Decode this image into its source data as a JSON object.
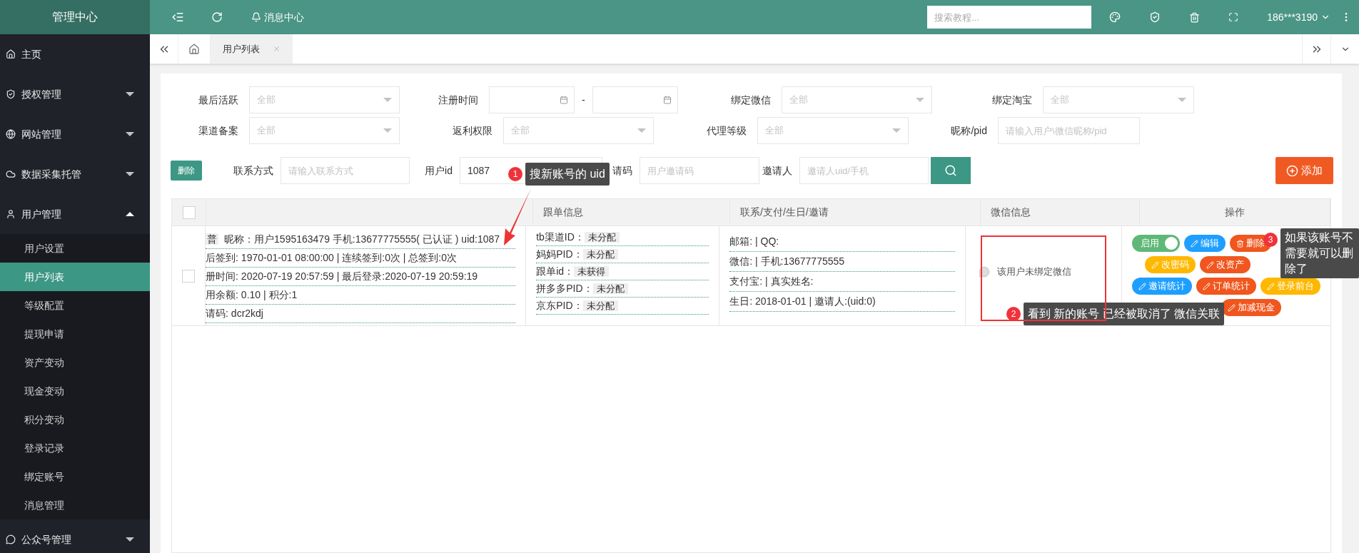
{
  "sidebar": {
    "title": "管理中心",
    "items": [
      {
        "label": "主页"
      },
      {
        "label": "授权管理",
        "expanded": false
      },
      {
        "label": "网站管理",
        "expanded": false
      },
      {
        "label": "数据采集托管",
        "expanded": false
      },
      {
        "label": "用户管理",
        "expanded": true,
        "children": [
          {
            "label": "用户设置",
            "selected": false
          },
          {
            "label": "用户列表",
            "selected": true
          },
          {
            "label": "等级配置",
            "selected": false
          },
          {
            "label": "提现申请",
            "selected": false
          },
          {
            "label": "资产变动",
            "selected": false
          },
          {
            "label": "现金变动",
            "selected": false
          },
          {
            "label": "积分变动",
            "selected": false
          },
          {
            "label": "登录记录",
            "selected": false
          },
          {
            "label": "绑定账号",
            "selected": false
          },
          {
            "label": "消息管理",
            "selected": false
          }
        ]
      },
      {
        "label": "公众号管理",
        "expanded": false
      }
    ]
  },
  "topbar": {
    "notice": "消息中心",
    "search_placeholder": "搜索教程...",
    "user": "186***3190"
  },
  "tabs": [
    {
      "label": "用户列表",
      "selected": true
    }
  ],
  "filter_rows": [
    [
      {
        "label": "最后活跃",
        "kind": "select",
        "placeholder": "全部"
      },
      {
        "label": "注册时间",
        "kind": "date_range",
        "separator": "-"
      },
      {
        "label": "绑定微信",
        "kind": "select",
        "placeholder": "全部"
      },
      {
        "label": "绑定淘宝",
        "kind": "select",
        "placeholder": "全部"
      }
    ],
    [
      {
        "label": "渠道备案",
        "kind": "select",
        "placeholder": "全部"
      },
      {
        "label": "返利权限",
        "kind": "select",
        "placeholder": "全部"
      },
      {
        "label": "代理等级",
        "kind": "select",
        "placeholder": "全部"
      },
      {
        "label": "昵称/pid",
        "kind": "text",
        "placeholder": "请输入用户\\微信昵称/pid"
      }
    ]
  ],
  "action_row": {
    "delete": "删除",
    "fields": [
      {
        "label": "联系方式",
        "placeholder": "请输入联系方式"
      },
      {
        "label": "用户id",
        "value": "1087"
      },
      {
        "label": "请码",
        "placeholder": "用户邀请码"
      },
      {
        "label": "邀请人",
        "placeholder": "邀请人uid/手机"
      }
    ],
    "add": "添加"
  },
  "table": {
    "header_checked": false,
    "columns": [
      "跟单信息",
      "联系/支付/生日/邀请",
      "微信信息",
      "操作"
    ],
    "rows": [
      {
        "checked": false,
        "user": {
          "tag": "普",
          "lines": [
            "昵称：用户1595163479  手机:13677775555( 已认证 )   uid:1087",
            "后签到: 1970-01-01 08:00:00  |  连续签到:0次  |  总签到:0次",
            "册时间: 2020-07-19 20:57:59  |  最后登录:2020-07-19 20:59:19",
            "用余额: 0.10  |  积分:1",
            "请码: dcr2kdj"
          ]
        },
        "tracking": [
          {
            "label": "tb渠道ID：",
            "value": "未分配"
          },
          {
            "label": "妈妈PID：",
            "value": "未分配"
          },
          {
            "label": "跟单id：",
            "value": "未获得"
          },
          {
            "label": "拼多多PID：",
            "value": "未分配"
          },
          {
            "label": "京东PID：",
            "value": "未分配"
          }
        ],
        "contact": [
          "邮箱:  |  QQ:",
          "微信:  |  手机:13677775555",
          "支付宝:  |  真实姓名:",
          "生日: 2018-01-01  |  邀请人:(uid:0)"
        ],
        "wechat": "该用户未绑定微信",
        "actions": [
          [
            {
              "kind": "toggle",
              "label": "启用",
              "on": true
            },
            {
              "kind": "edit",
              "label": "编辑",
              "color": "#1e9fff"
            },
            {
              "kind": "delete",
              "label": "删除",
              "color": "#f0561e"
            }
          ],
          [
            {
              "kind": "edit",
              "label": "改密码",
              "color": "#ffb800"
            },
            {
              "kind": "edit",
              "label": "改资产",
              "color": "#f0561e"
            }
          ],
          [
            {
              "kind": "edit",
              "label": "邀请统计",
              "color": "#1e9fff"
            },
            {
              "kind": "edit",
              "label": "订单统计",
              "color": "#f0561e"
            },
            {
              "kind": "edit",
              "label": "登录前台",
              "color": "#ffb800"
            }
          ],
          [
            {
              "kind": "edit",
              "label": "加减现金",
              "color": "#f0561e"
            }
          ]
        ]
      }
    ]
  },
  "annotations": [
    {
      "number": "1",
      "text": "搜新账号的 uid"
    },
    {
      "number": "2",
      "text": "看到 新的账号 已经被取消了 微信关联"
    },
    {
      "number": "3",
      "text": "如果该账号不需要就可以删除了"
    }
  ]
}
